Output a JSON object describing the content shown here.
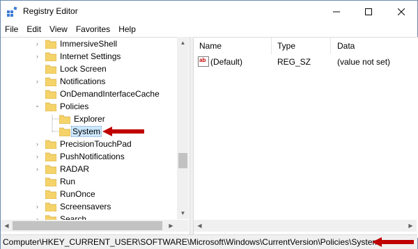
{
  "window": {
    "title": "Registry Editor"
  },
  "menu": [
    "File",
    "Edit",
    "View",
    "Favorites",
    "Help"
  ],
  "tree": {
    "items": [
      {
        "label": "ImmersiveShell",
        "expander": "›"
      },
      {
        "label": "Internet Settings",
        "expander": "›"
      },
      {
        "label": "Lock Screen",
        "expander": ""
      },
      {
        "label": "Notifications",
        "expander": "›"
      },
      {
        "label": "OnDemandInterfaceCache",
        "expander": ""
      },
      {
        "label": "Policies",
        "expander": "⌄"
      },
      {
        "label": "Explorer",
        "expander": ""
      },
      {
        "label": "System",
        "expander": "",
        "selected": true
      },
      {
        "label": "PrecisionTouchPad",
        "expander": "›"
      },
      {
        "label": "PushNotifications",
        "expander": "›"
      },
      {
        "label": "RADAR",
        "expander": "›"
      },
      {
        "label": "Run",
        "expander": ""
      },
      {
        "label": "RunOnce",
        "expander": ""
      },
      {
        "label": "Screensavers",
        "expander": "›"
      },
      {
        "label": "Search",
        "expander": "›"
      }
    ]
  },
  "list": {
    "columns": [
      "Name",
      "Type",
      "Data"
    ],
    "rows": [
      {
        "name": "(Default)",
        "type": "REG_SZ",
        "data": "(value not set)",
        "icon": "string-value-icon"
      }
    ],
    "icon_text": "ab"
  },
  "status": {
    "path": "Computer\\HKEY_CURRENT_USER\\SOFTWARE\\Microsoft\\Windows\\CurrentVersion\\Policies\\System"
  },
  "colors": {
    "annotation_arrow": "#c00000",
    "selection": "#cce8ff",
    "folder": "#f5d36b"
  }
}
